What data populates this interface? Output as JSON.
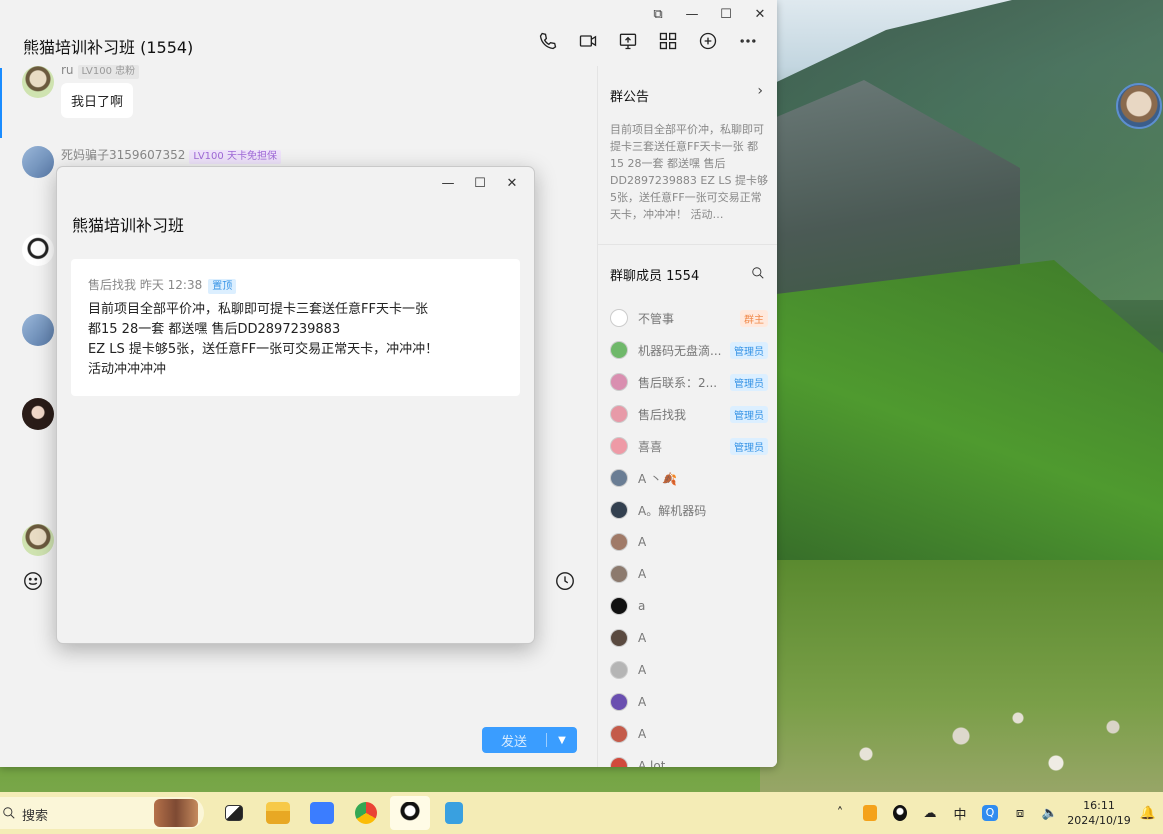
{
  "chat": {
    "title": "熊猫培训补习班 (1554)",
    "messages": [
      {
        "sender": "ru",
        "level": "LV100 忠粉",
        "text": "我日了啊"
      },
      {
        "sender": "死妈骗子3159607352",
        "level": "LV100 天卡免担保"
      }
    ],
    "send_label": "发送"
  },
  "sidebar": {
    "notice_title": "群公告",
    "notice_text": "目前项目全部平价冲，私聊即可提卡三套送任意FF天卡一张 都15 28一套 都送嘿 售后DD2897239883 EZ LS 提卡够5张，送任意FF一张可交易正常天卡，冲冲冲！ 活动…",
    "members_title": "群聊成员 1554",
    "members": [
      {
        "name": "不管事",
        "role": "群主",
        "role_type": "owner",
        "avatar_color": "#ffffff"
      },
      {
        "name": "机器码无盘滴...",
        "role": "管理员",
        "role_type": "admin",
        "avatar_color": "#6fb86a"
      },
      {
        "name": "售后联系：2...",
        "role": "管理员",
        "role_type": "admin",
        "avatar_color": "#d98fb0"
      },
      {
        "name": "售后找我",
        "role": "管理员",
        "role_type": "admin",
        "avatar_color": "#e79aa8"
      },
      {
        "name": "喜喜",
        "role": "管理员",
        "role_type": "admin",
        "avatar_color": "#ee9aa6"
      },
      {
        "name": "A 丶🍂",
        "role": "",
        "role_type": "",
        "avatar_color": "#6a7d94"
      },
      {
        "name": "A。解机器码",
        "role": "",
        "role_type": "",
        "avatar_color": "#33404f"
      },
      {
        "name": "A",
        "role": "",
        "role_type": "",
        "avatar_color": "#a07a68"
      },
      {
        "name": "A",
        "role": "",
        "role_type": "",
        "avatar_color": "#8c7a6e"
      },
      {
        "name": "a",
        "role": "",
        "role_type": "",
        "avatar_color": "#111111"
      },
      {
        "name": "A",
        "role": "",
        "role_type": "",
        "avatar_color": "#5a4a40"
      },
      {
        "name": "A",
        "role": "",
        "role_type": "",
        "avatar_color": "#b5b5b5"
      },
      {
        "name": "A",
        "role": "",
        "role_type": "",
        "avatar_color": "#6a4fb0"
      },
      {
        "name": "A",
        "role": "",
        "role_type": "",
        "avatar_color": "#c45b4a"
      },
      {
        "name": "A lot",
        "role": "",
        "role_type": "",
        "avatar_color": "#d14a3c"
      }
    ]
  },
  "popup": {
    "title": "熊猫培训补习班",
    "meta": "售后找我 昨天 12:38",
    "pin_label": "置顶",
    "body_lines": [
      "目前项目全部平价冲，私聊即可提卡三套送任意FF天卡一张",
      "都15 28一套 都送嘿 售后DD2897239883",
      "EZ LS 提卡够5张，送任意FF一张可交易正常天卡，冲冲冲！",
      "活动冲冲冲冲"
    ]
  },
  "taskbar": {
    "search_placeholder": "搜索",
    "time": "16:11",
    "date": "2024/10/19",
    "ime": "中"
  },
  "colors": {
    "accent": "#3a9dff",
    "admin_badge": "#3593e6",
    "owner_badge": "#f08a4b",
    "taskbar_bg": "#f4ecb6"
  }
}
